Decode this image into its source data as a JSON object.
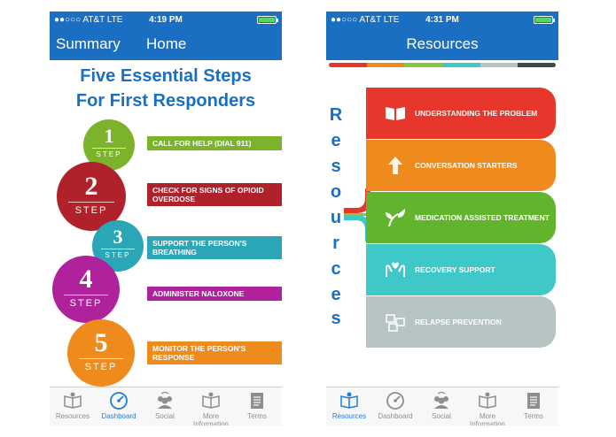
{
  "left_screen": {
    "status": {
      "carrier": "●●○○○ AT&T  LTE",
      "time": "4:19 PM"
    },
    "nav": {
      "back_label": "Summary",
      "title": "Home"
    },
    "title_line1": "Five Essential Steps",
    "title_line2": "For First Responders",
    "step_word": "STEP",
    "steps": [
      {
        "number": "1",
        "label": "CALL FOR HELP (DIAL 911)",
        "color": "#7cb32a"
      },
      {
        "number": "2",
        "label": "CHECK FOR SIGNS OF OPIOID OVERDOSE",
        "color": "#b0212a"
      },
      {
        "number": "3",
        "label": "SUPPORT THE PERSON'S BREATHING",
        "color": "#2ba6b6"
      },
      {
        "number": "4",
        "label": "ADMINISTER NALOXONE",
        "color": "#b0229c"
      },
      {
        "number": "5",
        "label": "MONITOR THE PERSON'S RESPONSE",
        "color": "#ef8a1d"
      }
    ],
    "tabs": [
      {
        "label": "Resources",
        "icon": "resources-icon",
        "active": false
      },
      {
        "label": "Dashboard",
        "icon": "dashboard-icon",
        "active": true
      },
      {
        "label": "Social",
        "icon": "social-icon",
        "active": false
      },
      {
        "label": "More Information",
        "icon": "more-information-icon",
        "active": false
      },
      {
        "label": "Terms",
        "icon": "terms-icon",
        "active": false
      }
    ]
  },
  "right_screen": {
    "status": {
      "carrier": "●●○○○ AT&T  LTE",
      "time": "4:31 PM"
    },
    "nav": {
      "title": "Resources"
    },
    "progress_colors": [
      "#e7362b",
      "#ef8a1d",
      "#86c540",
      "#3fc8c8",
      "#b6c4c4",
      "#3a4a4a"
    ],
    "vertical_word": [
      "R",
      "e",
      "s",
      "o",
      "u",
      "r",
      "c",
      "e",
      "s"
    ],
    "items": [
      {
        "label": "UNDERSTANDING THE PROBLEM",
        "icon": "book-icon",
        "color": "#e7362b"
      },
      {
        "label": "CONVERSATION STARTERS",
        "icon": "arrow-up-icon",
        "color": "#ef8a1d"
      },
      {
        "label": "MEDICATION ASSISTED TREATMENT",
        "icon": "leaf-icon",
        "color": "#62b42d"
      },
      {
        "label": "RECOVERY SUPPORT",
        "icon": "hands-icon",
        "color": "#3fc8c8"
      },
      {
        "label": "RELAPSE PREVENTION",
        "icon": "puzzle-icon",
        "color": "#b6c4c4"
      }
    ],
    "tabs": [
      {
        "label": "Resources",
        "icon": "resources-icon",
        "active": true
      },
      {
        "label": "Dashboard",
        "icon": "dashboard-icon",
        "active": false
      },
      {
        "label": "Social",
        "icon": "social-icon",
        "active": false
      },
      {
        "label": "More Information",
        "icon": "more-information-icon",
        "active": false
      },
      {
        "label": "Terms",
        "icon": "terms-icon",
        "active": false
      }
    ]
  }
}
